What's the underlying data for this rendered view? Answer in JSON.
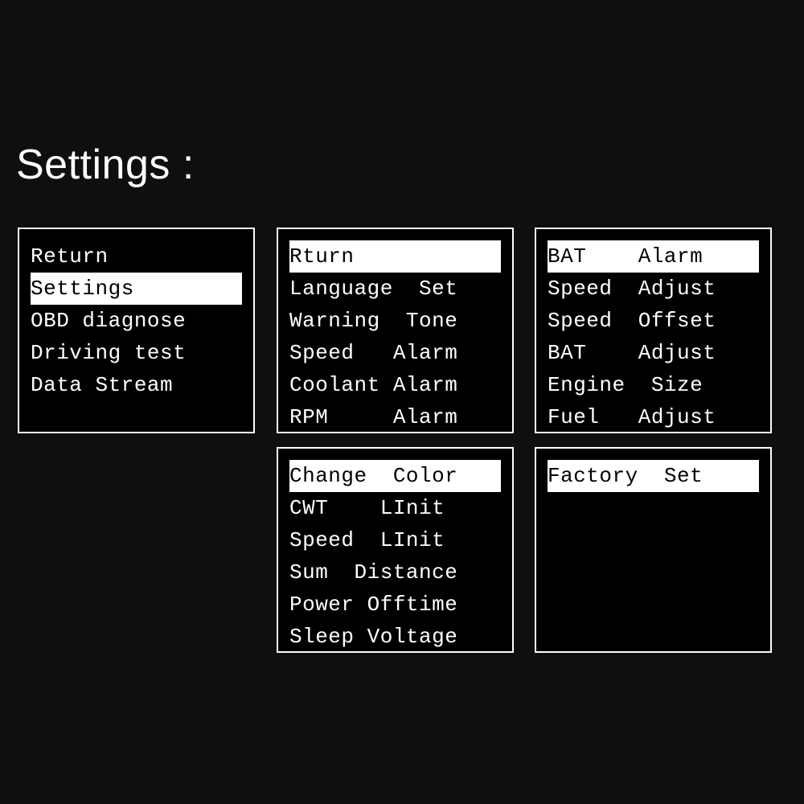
{
  "title": "Settings :",
  "panels": [
    {
      "id": "p0",
      "items": [
        {
          "text": "Return",
          "selected": false
        },
        {
          "text": "Settings",
          "selected": true
        },
        {
          "text": "OBD diagnose",
          "selected": false
        },
        {
          "text": "Driving test",
          "selected": false
        },
        {
          "text": "Data Stream",
          "selected": false
        }
      ]
    },
    {
      "id": "p1",
      "items": [
        {
          "text": "Rturn",
          "selected": true
        },
        {
          "text": "Language  Set",
          "selected": false
        },
        {
          "text": "Warning  Tone",
          "selected": false
        },
        {
          "text": "Speed   Alarm",
          "selected": false
        },
        {
          "text": "Coolant Alarm",
          "selected": false
        },
        {
          "text": "RPM     Alarm",
          "selected": false
        }
      ]
    },
    {
      "id": "p2",
      "items": [
        {
          "text": "BAT    Alarm",
          "selected": true
        },
        {
          "text": "Speed  Adjust",
          "selected": false
        },
        {
          "text": "Speed  Offset",
          "selected": false
        },
        {
          "text": "BAT    Adjust",
          "selected": false
        },
        {
          "text": "Engine  Size",
          "selected": false
        },
        {
          "text": "Fuel   Adjust",
          "selected": false
        }
      ]
    },
    {
      "id": "p3",
      "items": [
        {
          "text": "Change  Color",
          "selected": true
        },
        {
          "text": "CWT    LInit",
          "selected": false
        },
        {
          "text": "Speed  LInit",
          "selected": false
        },
        {
          "text": "Sum  Distance",
          "selected": false
        },
        {
          "text": "Power Offtime",
          "selected": false
        },
        {
          "text": "Sleep Voltage",
          "selected": false
        }
      ]
    },
    {
      "id": "p4",
      "items": [
        {
          "text": "Factory  Set",
          "selected": true
        }
      ]
    }
  ]
}
